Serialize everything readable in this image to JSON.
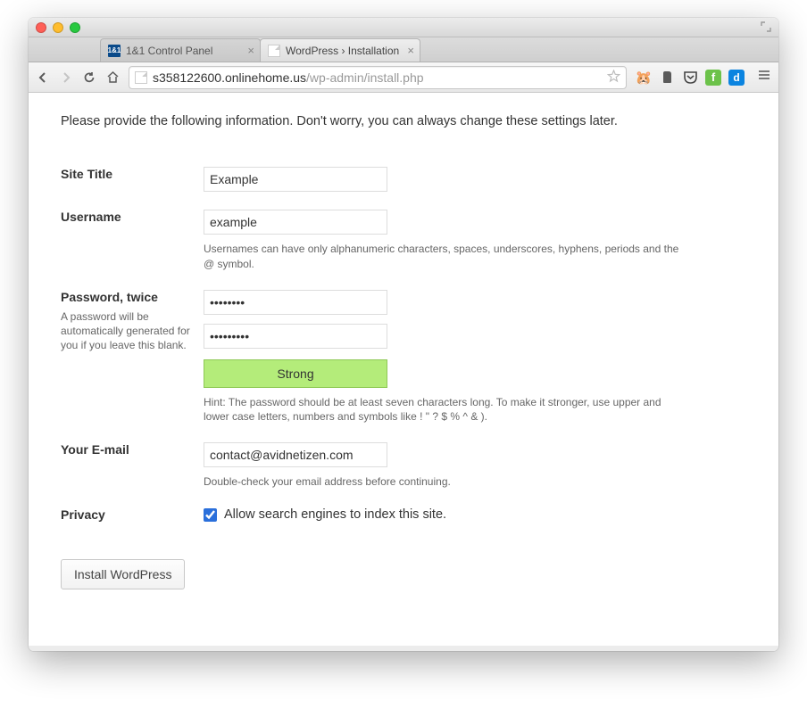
{
  "window": {
    "tabs": [
      {
        "label": "1&1 Control Panel",
        "favicon_text": "1&1"
      },
      {
        "label": "WordPress › Installation",
        "favicon_text": ""
      }
    ],
    "url_host": "s358122600.onlinehome.us",
    "url_path": "/wp-admin/install.php"
  },
  "intro": "Please provide the following information. Don't worry, you can always change these settings later.",
  "fields": {
    "site_title": {
      "label": "Site Title",
      "value": "Example"
    },
    "username": {
      "label": "Username",
      "value": "example",
      "hint": "Usernames can have only alphanumeric characters, spaces, underscores, hyphens, periods and the @ symbol."
    },
    "password": {
      "label": "Password, twice",
      "sublabel": "A password will be automatically generated for you if you leave this blank.",
      "value1": "••••••••",
      "value2": "•••••••••",
      "strength": "Strong",
      "hint": "Hint: The password should be at least seven characters long. To make it stronger, use upper and lower case letters, numbers and symbols like ! \" ? $ % ^ & )."
    },
    "email": {
      "label": "Your E-mail",
      "value": "contact@avidnetizen.com",
      "hint": "Double-check your email address before continuing."
    },
    "privacy": {
      "label": "Privacy",
      "checkbox_label": "Allow search engines to index this site.",
      "checked": true
    }
  },
  "submit_label": "Install WordPress"
}
